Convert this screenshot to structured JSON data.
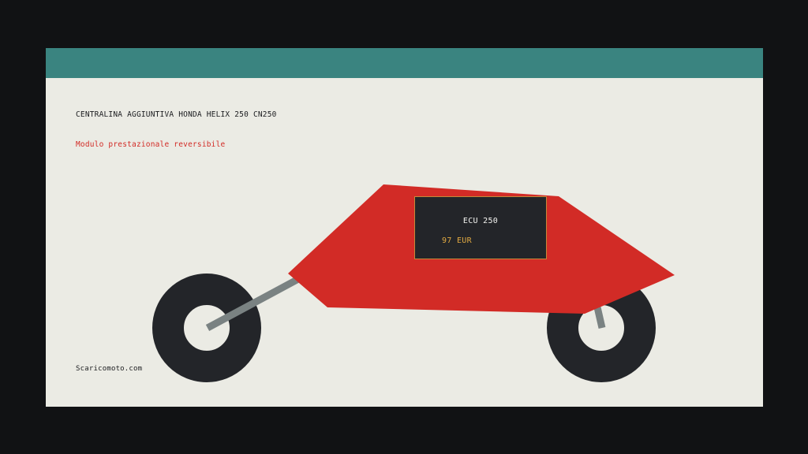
{
  "product": {
    "title": "CENTRALINA AGGIUNTIVA HONDA HELIX 250 CN250",
    "subtitle": "Modulo prestazionale reversibile"
  },
  "tag": {
    "name": "ECU 250",
    "price": "97 EUR"
  },
  "footer": {
    "site": "Scaricomoto.com"
  },
  "colors": {
    "header_bar": "#3a8480",
    "background": "#ebebe4",
    "body": "#d22b26",
    "tag_border": "#c38a3a",
    "price": "#e0a942",
    "wheel": "#232529",
    "fork": "#7a8282"
  }
}
